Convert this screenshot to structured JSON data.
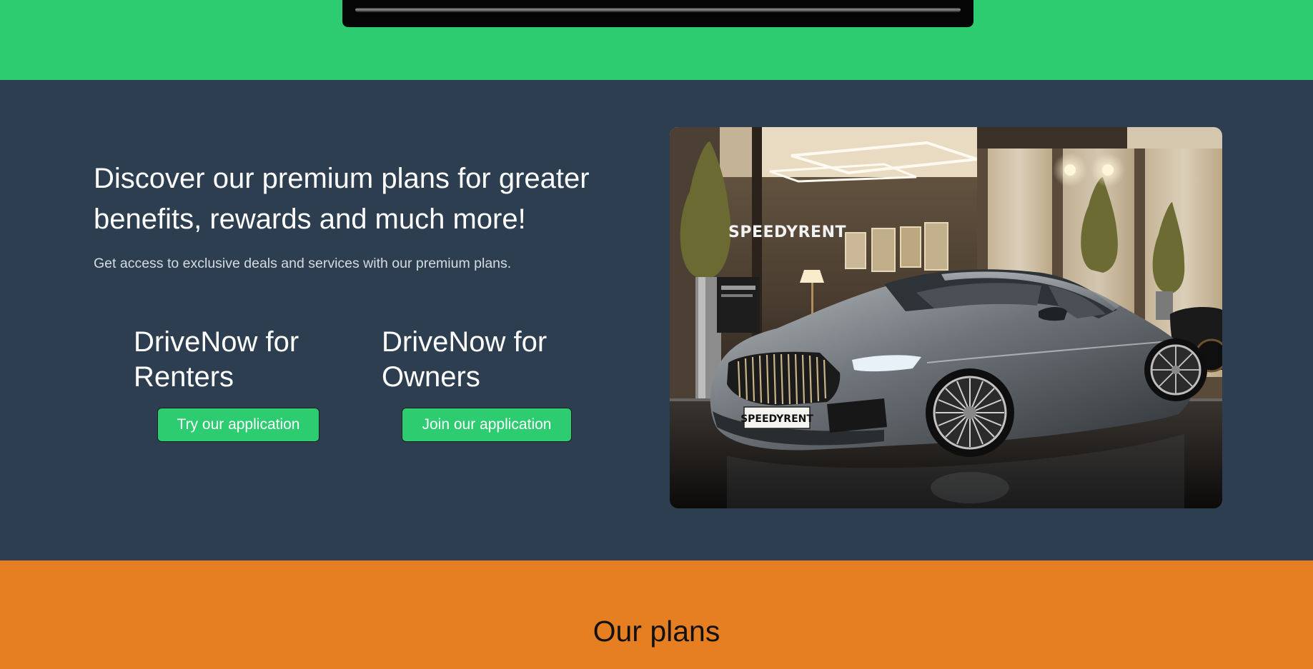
{
  "hero": {
    "title": "Discover our premium plans for greater benefits, rewards and much more!",
    "subtitle": "Get access to exclusive deals and services with our premium plans.",
    "plans": [
      {
        "title": "DriveNow for Renters",
        "button_label": "Try our application"
      },
      {
        "title": "DriveNow for Owners",
        "button_label": "Join our application"
      }
    ],
    "image": {
      "showroom_sign": "SPEEDYRENT",
      "license_plate": "SPEEDYRENT"
    }
  },
  "plans_section": {
    "title": "Our plans"
  },
  "colors": {
    "top_band": "#2ecc71",
    "hero_background": "#2c3e50",
    "button": "#2ecc71",
    "plans_band": "#e67e22"
  }
}
